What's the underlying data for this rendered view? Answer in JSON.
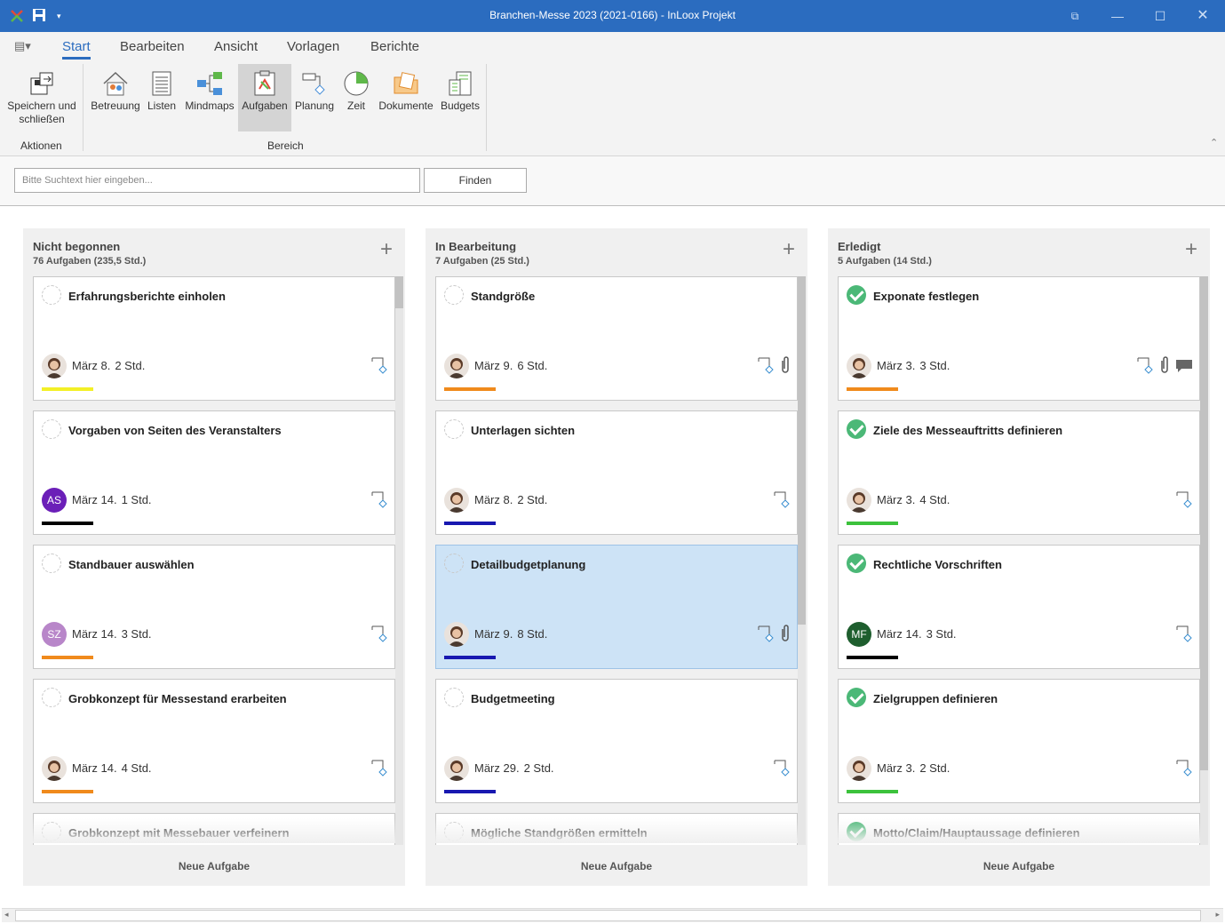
{
  "window": {
    "title": "Branchen-Messe 2023 (2021-0166) - InLoox Projekt"
  },
  "menu": {
    "items": [
      "Start",
      "Bearbeiten",
      "Ansicht",
      "Vorlagen",
      "Berichte"
    ],
    "active": "Start"
  },
  "ribbon": {
    "aktionen": {
      "label": "Aktionen",
      "save_label": "Speichern und schließen"
    },
    "bereich": {
      "label": "Bereich",
      "buttons": [
        "Betreuung",
        "Listen",
        "Mindmaps",
        "Aufgaben",
        "Planung",
        "Zeit",
        "Dokumente",
        "Budgets"
      ],
      "active": "Aufgaben"
    }
  },
  "search": {
    "placeholder": "Bitte Suchtext hier eingeben...",
    "find_label": "Finden"
  },
  "colors": {
    "accent": "#2b6cbf",
    "done": "#4bb877",
    "selected": "#cde3f6"
  },
  "columns": [
    {
      "title": "Nicht begonnen",
      "summary": "76 Aufgaben (235,5 Std.)",
      "add_icon": "plus-icon",
      "new_task": "Neue Aufgabe",
      "cards": [
        {
          "title": "Erfahrungsberichte einholen",
          "date": "März 8.",
          "hours": "2 Std.",
          "avatar": {
            "type": "photo",
            "initials": ""
          },
          "bar": "#f3f026",
          "icons": [
            "planning-icon"
          ],
          "done": false,
          "selected": false
        },
        {
          "title": "Vorgaben von Seiten des Veranstalters",
          "date": "März 14.",
          "hours": "1 Std.",
          "avatar": {
            "type": "initials",
            "initials": "AS",
            "color": "#6b1fb8"
          },
          "bar": "#000000",
          "icons": [
            "planning-icon"
          ],
          "done": false,
          "selected": false
        },
        {
          "title": "Standbauer auswählen",
          "date": "März 14.",
          "hours": "3 Std.",
          "avatar": {
            "type": "initials",
            "initials": "SZ",
            "color": "#b886c9"
          },
          "bar": "#f08a1c",
          "icons": [
            "planning-icon"
          ],
          "done": false,
          "selected": false
        },
        {
          "title": "Grobkonzept für Messestand erarbeiten",
          "date": "März 14.",
          "hours": "4 Std.",
          "avatar": {
            "type": "photo",
            "initials": ""
          },
          "bar": "#f08a1c",
          "icons": [
            "planning-icon"
          ],
          "done": false,
          "selected": false
        },
        {
          "title": "Grobkonzept mit Messebauer verfeinern",
          "date": "",
          "hours": "",
          "avatar": null,
          "bar": null,
          "icons": [],
          "done": false,
          "selected": false
        }
      ]
    },
    {
      "title": "In Bearbeitung",
      "summary": "7 Aufgaben (25 Std.)",
      "add_icon": "plus-icon",
      "new_task": "Neue Aufgabe",
      "cards": [
        {
          "title": "Standgröße",
          "date": "März 9.",
          "hours": "6 Std.",
          "avatar": {
            "type": "photo",
            "initials": ""
          },
          "bar": "#f08a1c",
          "icons": [
            "planning-icon",
            "attachment-icon"
          ],
          "done": false,
          "selected": false
        },
        {
          "title": "Unterlagen sichten",
          "date": "März 8.",
          "hours": "2 Std.",
          "avatar": {
            "type": "photo",
            "initials": ""
          },
          "bar": "#1818b0",
          "icons": [
            "planning-icon"
          ],
          "done": false,
          "selected": false
        },
        {
          "title": "Detailbudgetplanung",
          "date": "März 9.",
          "hours": "8 Std.",
          "avatar": {
            "type": "photo",
            "initials": ""
          },
          "bar": "#1818b0",
          "icons": [
            "planning-icon",
            "attachment-icon"
          ],
          "done": false,
          "selected": true
        },
        {
          "title": "Budgetmeeting",
          "date": "März 29.",
          "hours": "2 Std.",
          "avatar": {
            "type": "photo",
            "initials": ""
          },
          "bar": "#1818b0",
          "icons": [
            "planning-icon"
          ],
          "done": false,
          "selected": false
        },
        {
          "title": "Mögliche Standgrößen ermitteln",
          "date": "",
          "hours": "",
          "avatar": null,
          "bar": null,
          "icons": [],
          "done": false,
          "selected": false
        }
      ]
    },
    {
      "title": "Erledigt",
      "summary": "5 Aufgaben (14 Std.)",
      "add_icon": "plus-icon",
      "new_task": "Neue Aufgabe",
      "cards": [
        {
          "title": "Exponate festlegen",
          "date": "März 3.",
          "hours": "3 Std.",
          "avatar": {
            "type": "photo",
            "initials": ""
          },
          "bar": "#f08a1c",
          "icons": [
            "planning-icon",
            "attachment-icon",
            "comment-icon"
          ],
          "done": true,
          "selected": false
        },
        {
          "title": "Ziele des Messeauftritts definieren",
          "date": "März 3.",
          "hours": "4 Std.",
          "avatar": {
            "type": "photo",
            "initials": ""
          },
          "bar": "#3cc23c",
          "icons": [
            "planning-icon"
          ],
          "done": true,
          "selected": false
        },
        {
          "title": "Rechtliche Vorschriften",
          "date": "März 14.",
          "hours": "3 Std.",
          "avatar": {
            "type": "initials",
            "initials": "MF",
            "color": "#1e5e2e"
          },
          "bar": "#000000",
          "icons": [
            "planning-icon"
          ],
          "done": true,
          "selected": false
        },
        {
          "title": "Zielgruppen definieren",
          "date": "März 3.",
          "hours": "2 Std.",
          "avatar": {
            "type": "photo",
            "initials": ""
          },
          "bar": "#3cc23c",
          "icons": [
            "planning-icon"
          ],
          "done": true,
          "selected": false
        },
        {
          "title": "Motto/Claim/Hauptaussage definieren",
          "date": "",
          "hours": "",
          "avatar": null,
          "bar": null,
          "icons": [],
          "done": true,
          "selected": false
        }
      ]
    }
  ]
}
